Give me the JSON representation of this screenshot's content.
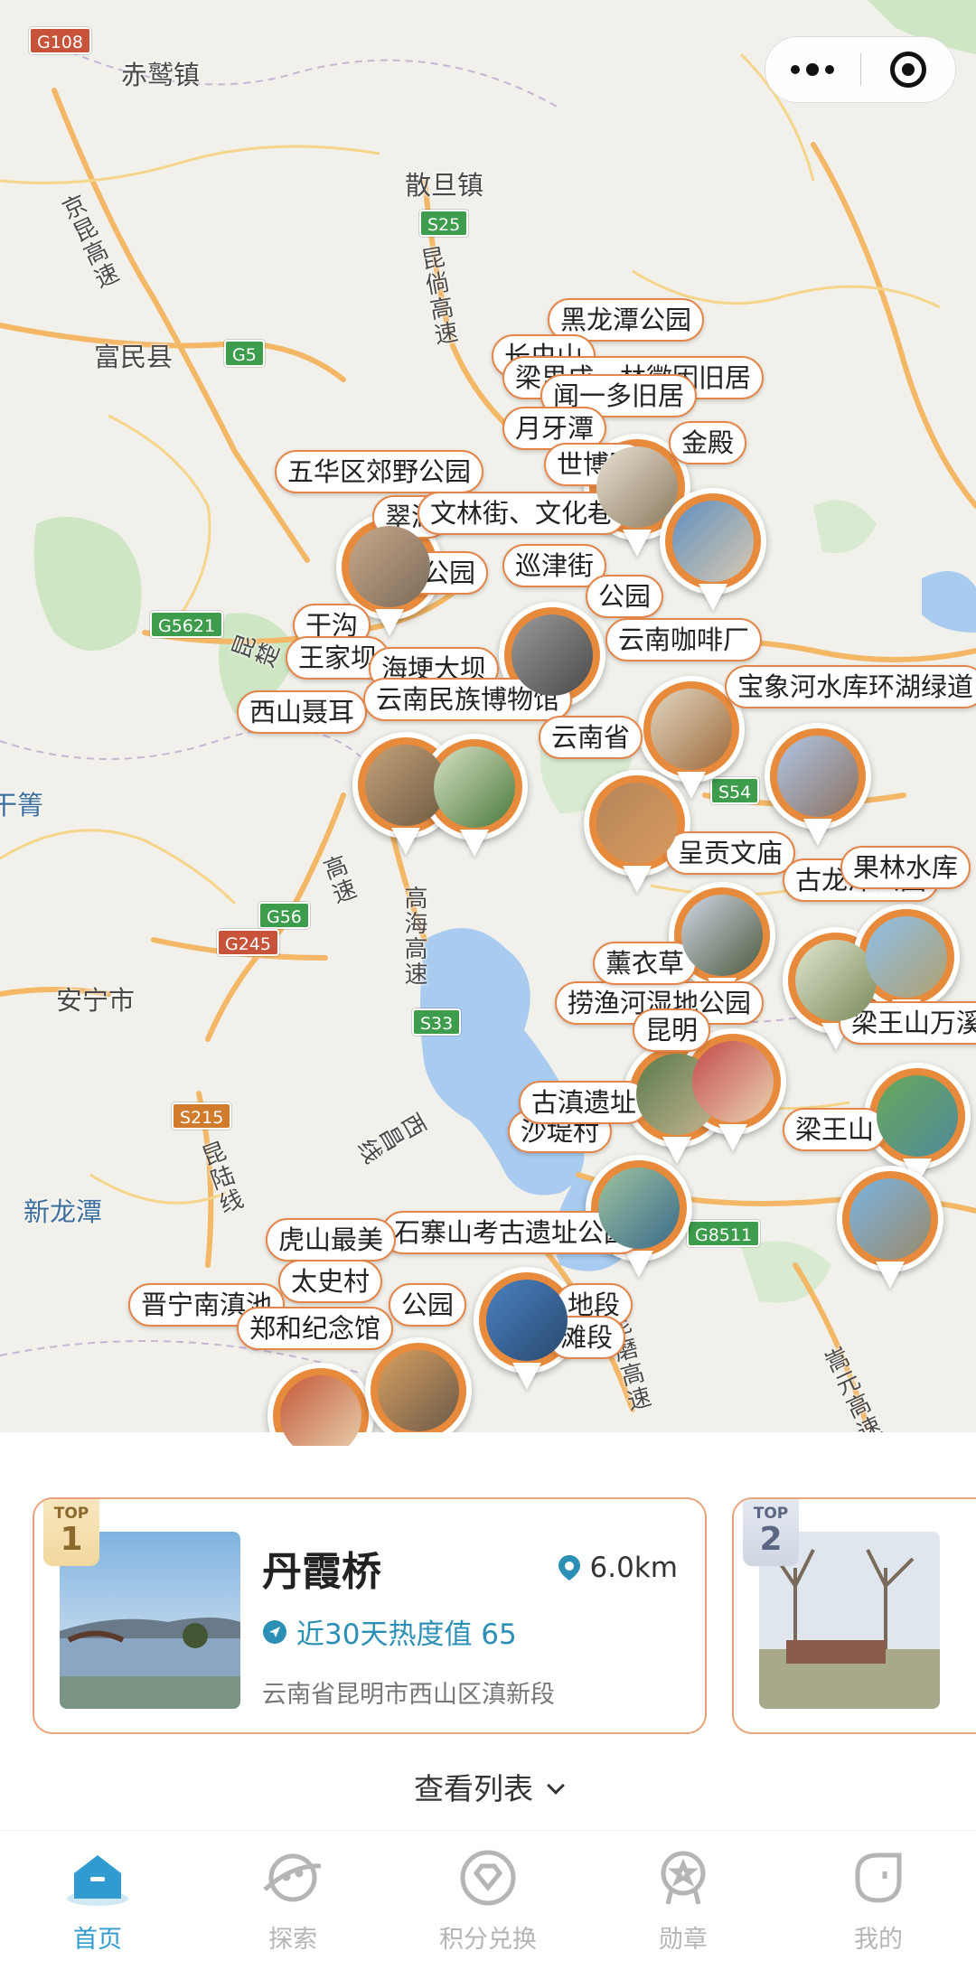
{
  "capsule": {
    "more_icon": "more-dots-icon",
    "close_icon": "target-close-icon"
  },
  "map": {
    "towns": [
      {
        "id": "chiezhen",
        "name": "赤鹫镇"
      },
      {
        "id": "sandan",
        "name": "散旦镇"
      },
      {
        "id": "fumin",
        "name": "富民县"
      },
      {
        "id": "anning",
        "name": "安宁市"
      },
      {
        "id": "xinlongtan",
        "name": "新龙潭"
      },
      {
        "id": "qiangan",
        "name": "干箐"
      }
    ],
    "roads": [
      {
        "id": "jingkun",
        "name": "京昆高速"
      },
      {
        "id": "kundao",
        "name": "昆倘高速"
      },
      {
        "id": "gaohai",
        "name": "高海高速"
      },
      {
        "id": "xichang",
        "name": "西昌线"
      },
      {
        "id": "kunlu",
        "name": "昆陆线"
      },
      {
        "id": "kunmo",
        "name": "昆磨高速"
      },
      {
        "id": "songming",
        "name": "嵩元高速"
      },
      {
        "id": "gao",
        "name": "高速"
      },
      {
        "id": "kunchu",
        "name": "昆楚"
      }
    ],
    "shields": [
      {
        "id": "g108",
        "code": "G108"
      },
      {
        "id": "s25",
        "code": "S25"
      },
      {
        "id": "g5",
        "code": "G5"
      },
      {
        "id": "g5621",
        "code": "G5621"
      },
      {
        "id": "g56",
        "code": "G56"
      },
      {
        "id": "g245",
        "code": "G245"
      },
      {
        "id": "s33",
        "code": "S33"
      },
      {
        "id": "s215",
        "code": "S215"
      },
      {
        "id": "s54",
        "code": "S54"
      },
      {
        "id": "g8511",
        "code": "G8511"
      }
    ],
    "pois": [
      "黑龙潭公园",
      "梁思成、林徽因旧居",
      "闻一多旧居",
      "五华区郊野公园",
      "文林街、文化巷",
      "翠湖",
      "大观公园",
      "巡津街",
      "公园",
      "云南咖啡厂",
      "干沟",
      "王家坝",
      "海埂大坝",
      "西山聂耳",
      "云南民族博物馆",
      "宝象河水库环湖绿道",
      "云南省",
      "呈贡文庙",
      "古龙潭公园",
      "果林水库",
      "捞渔河湿地公园",
      "薰衣草",
      "梁王山万溪冲",
      "梁王山",
      "沙堤村",
      "古滇遗址",
      "石寨山考古遗址公园",
      "虎山最美",
      "太史村",
      "晋宁南滇池",
      "郑和纪念馆",
      "公园",
      "地段",
      "滩段",
      "长虫山",
      "月牙潭",
      "世博园",
      "金殿",
      "昆明"
    ]
  },
  "cards": [
    {
      "rank_top": "TOP",
      "rank_num": "1",
      "title": "丹霞桥",
      "distance": "6.0km",
      "heat": "近30天热度值 65",
      "address": "云南省昆明市西山区滇新段"
    },
    {
      "rank_top": "TOP",
      "rank_num": "2"
    }
  ],
  "view_list": "查看列表",
  "tabs": [
    {
      "label": "首页",
      "icon": "home-icon",
      "active": true
    },
    {
      "label": "探索",
      "icon": "planet-icon",
      "active": false
    },
    {
      "label": "积分兑换",
      "icon": "diamond-icon",
      "active": false
    },
    {
      "label": "勋章",
      "icon": "medal-icon",
      "active": false
    },
    {
      "label": "我的",
      "icon": "profile-icon",
      "active": false
    }
  ],
  "colors": {
    "accent": "#2f9bd1",
    "pin_orange": "#e88a3c",
    "card_border": "#e9a37c"
  }
}
